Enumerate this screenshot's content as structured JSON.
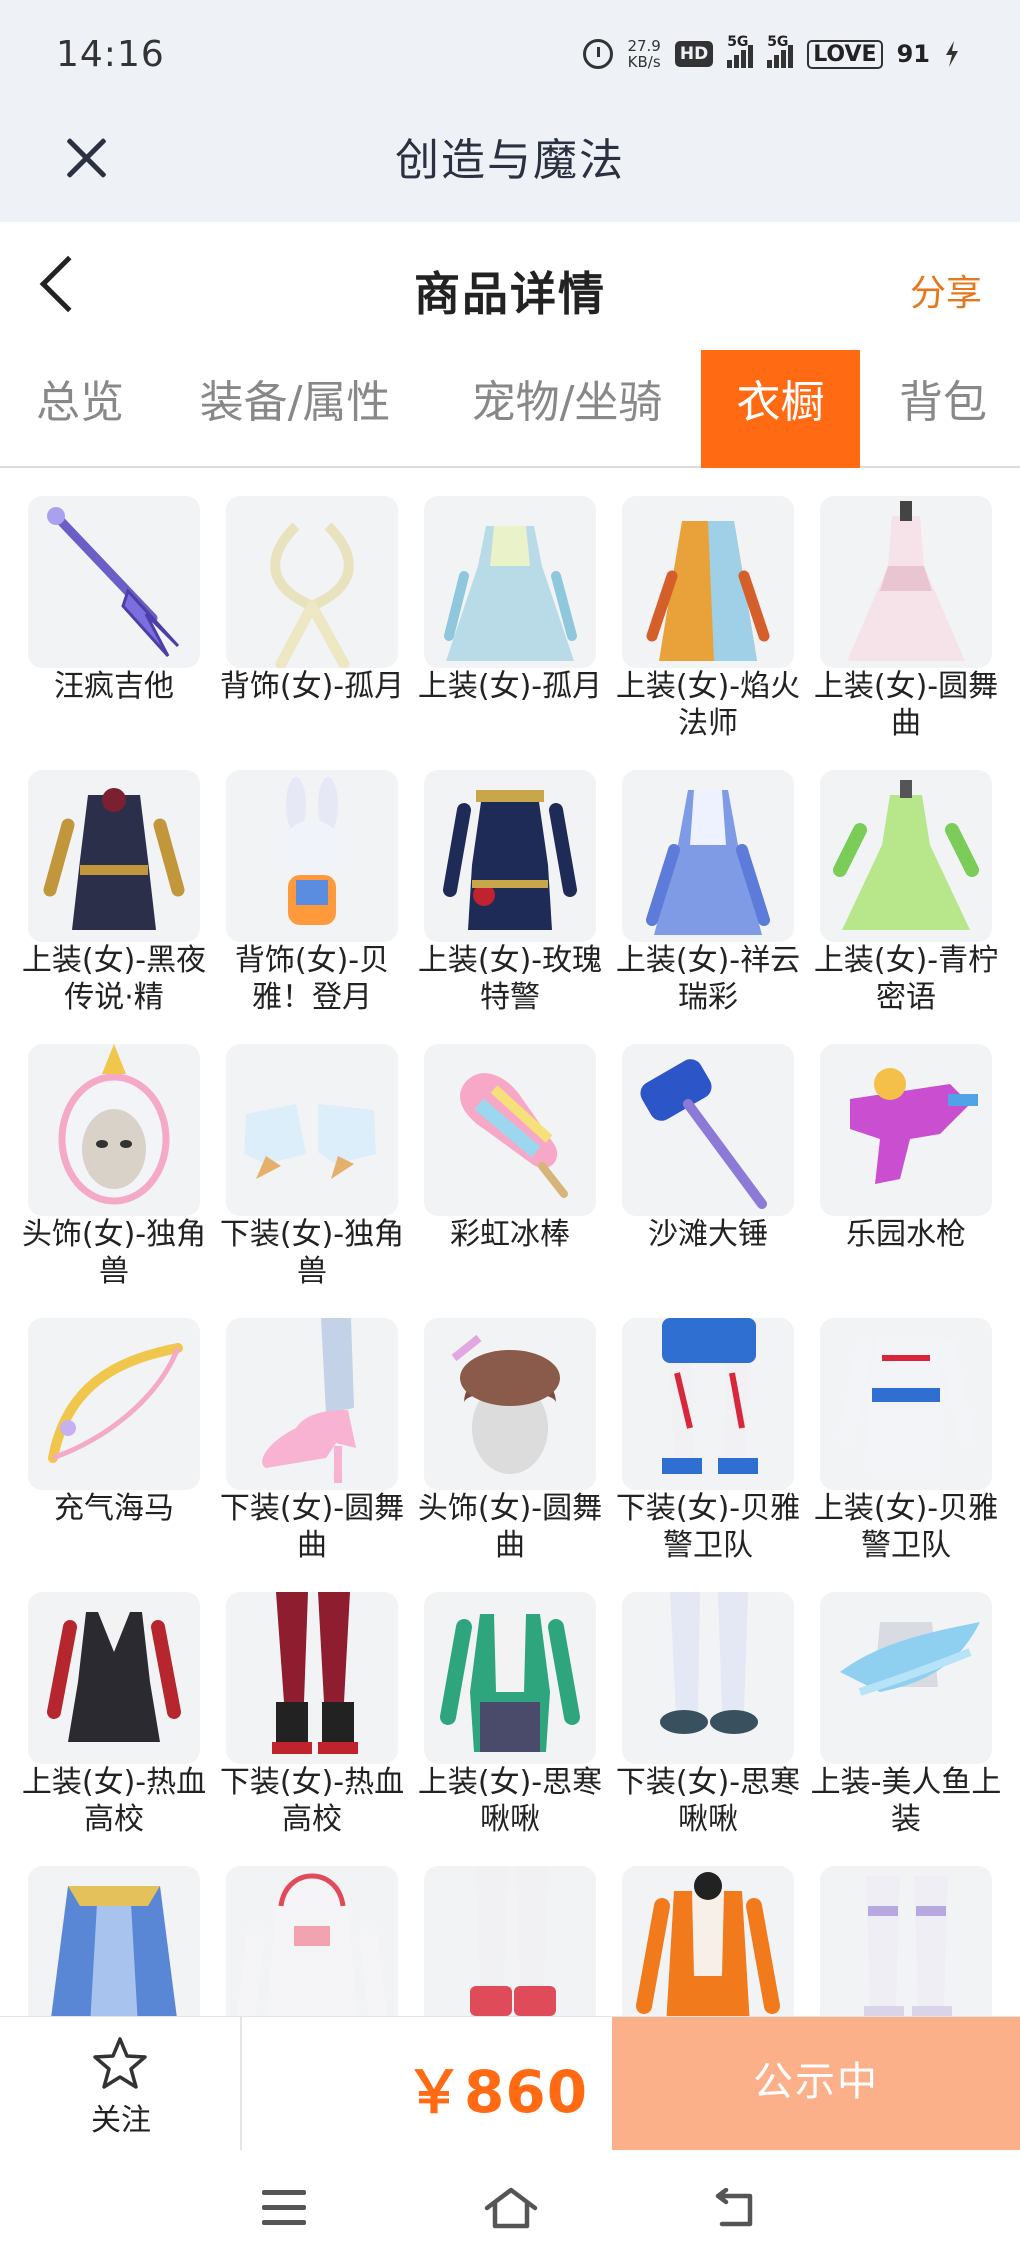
{
  "status_bar": {
    "time": "14:16",
    "net_speed_value": "27.9",
    "net_speed_unit": "KB/s",
    "hd_label": "HD",
    "signal1_label": "5G",
    "signal2_label": "5G",
    "battery_label": "LOVE",
    "battery_level": "91"
  },
  "titlebar": {
    "title": "创造与魔法"
  },
  "header": {
    "title": "商品详情",
    "share_label": "分享"
  },
  "tabs": [
    {
      "label": "总览",
      "active": false
    },
    {
      "label": "装备/属性",
      "active": false
    },
    {
      "label": "宠物/坐骑",
      "active": false
    },
    {
      "label": "衣橱",
      "active": true
    },
    {
      "label": "背包",
      "active": false
    }
  ],
  "items": [
    {
      "name": "汪疯吉他",
      "icon": "guitar"
    },
    {
      "name": "背饰(女)-孤月",
      "icon": "ribbon-back"
    },
    {
      "name": "上装(女)-孤月",
      "icon": "dress-blue"
    },
    {
      "name": "上装(女)-焰火法师",
      "icon": "mage-robe"
    },
    {
      "name": "上装(女)-圆舞曲",
      "icon": "gown-pink"
    },
    {
      "name": "上装(女)-黑夜传说·精",
      "icon": "dark-armor"
    },
    {
      "name": "背饰(女)-贝雅！登月",
      "icon": "bunny"
    },
    {
      "name": "上装(女)-玫瑰特警",
      "icon": "police-coat"
    },
    {
      "name": "上装(女)-祥云瑞彩",
      "icon": "cloud-robe"
    },
    {
      "name": "上装(女)-青柠密语",
      "icon": "lime-dress"
    },
    {
      "name": "头饰(女)-独角兽",
      "icon": "unicorn-hood"
    },
    {
      "name": "下装(女)-独角兽",
      "icon": "unicorn-boots"
    },
    {
      "name": "彩虹冰棒",
      "icon": "popsicle"
    },
    {
      "name": "沙滩大锤",
      "icon": "hammer"
    },
    {
      "name": "乐园水枪",
      "icon": "water-gun"
    },
    {
      "name": "充气海马",
      "icon": "bow"
    },
    {
      "name": "下装(女)-圆舞曲",
      "icon": "high-heels"
    },
    {
      "name": "头饰(女)-圆舞曲",
      "icon": "hat-head"
    },
    {
      "name": "下装(女)-贝雅警卫队",
      "icon": "guard-legs"
    },
    {
      "name": "上装(女)-贝雅警卫队",
      "icon": "guard-jacket"
    },
    {
      "name": "上装(女)-热血高校",
      "icon": "school-jacket"
    },
    {
      "name": "下装(女)-热血高校",
      "icon": "red-tights"
    },
    {
      "name": "上装(女)-思寒啾啾",
      "icon": "green-jacket"
    },
    {
      "name": "下装(女)-思寒啾啾",
      "icon": "white-socks"
    },
    {
      "name": "上装-美人鱼上装",
      "icon": "mermaid-top"
    },
    {
      "name": "",
      "icon": "blue-cape"
    },
    {
      "name": "",
      "icon": "white-hoodie"
    },
    {
      "name": "",
      "icon": "white-boots"
    },
    {
      "name": "",
      "icon": "orange-jacket"
    },
    {
      "name": "",
      "icon": "white-armor-legs"
    }
  ],
  "action_bar": {
    "follow_label": "关注",
    "price": "￥860",
    "status_label": "公示中"
  },
  "colors": {
    "accent": "#ff6a13",
    "status_button": "#fbb08a",
    "share": "#e5771d",
    "background_top": "#eef2f7"
  }
}
